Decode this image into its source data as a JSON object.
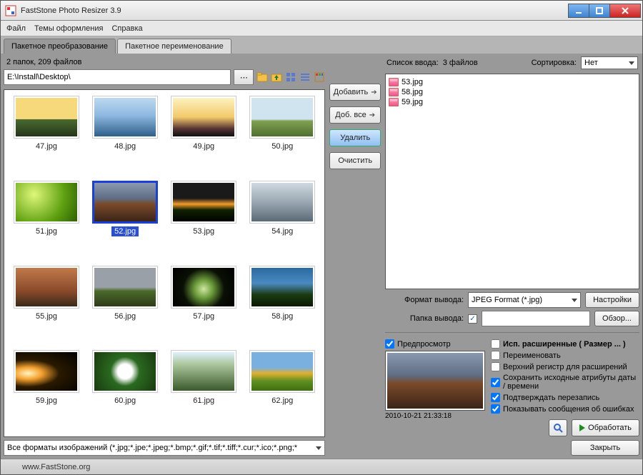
{
  "title": "FastStone Photo Resizer 3.9",
  "menus": {
    "file": "Файл",
    "themes": "Темы оформления",
    "help": "Справка"
  },
  "tabs": {
    "convert": "Пакетное преобразование",
    "rename": "Пакетное переименование"
  },
  "folder_info": "2 папок, 209 файлов",
  "path": "E:\\Install\\Desktop\\",
  "thumbs": [
    {
      "name": "47.jpg",
      "cls": "g-sunset"
    },
    {
      "name": "48.jpg",
      "cls": "g-aerial"
    },
    {
      "name": "49.jpg",
      "cls": "g-sky"
    },
    {
      "name": "50.jpg",
      "cls": "g-field"
    },
    {
      "name": "51.jpg",
      "cls": "g-leaf"
    },
    {
      "name": "52.jpg",
      "cls": "g-mount",
      "selected": true
    },
    {
      "name": "53.jpg",
      "cls": "g-dusk"
    },
    {
      "name": "54.jpg",
      "cls": "g-snowmt"
    },
    {
      "name": "55.jpg",
      "cls": "g-canyon"
    },
    {
      "name": "56.jpg",
      "cls": "g-barn"
    },
    {
      "name": "57.jpg",
      "cls": "g-cave"
    },
    {
      "name": "58.jpg",
      "cls": "g-fantasy"
    },
    {
      "name": "59.jpg",
      "cls": "g-space"
    },
    {
      "name": "60.jpg",
      "cls": "g-flower"
    },
    {
      "name": "61.jpg",
      "cls": "g-forest"
    },
    {
      "name": "62.jpg",
      "cls": "g-meadow"
    }
  ],
  "ext_filter": "Все форматы изображений (*.jpg;*.jpe;*.jpeg;*.bmp;*.gif;*.tif;*.tiff;*.cur;*.ico;*.png;*",
  "midbtns": {
    "add": "Добавить",
    "addall": "Доб. все",
    "remove": "Удалить",
    "clear": "Очистить"
  },
  "input_list": {
    "label": "Список ввода:",
    "count": "3 файлов",
    "items": [
      "53.jpg",
      "58.jpg",
      "59.jpg"
    ]
  },
  "sort": {
    "label": "Сортировка:",
    "value": "Нет"
  },
  "out_format": {
    "label": "Формат вывода:",
    "value": "JPEG Format (*.jpg)",
    "settings": "Настройки"
  },
  "out_folder": {
    "label": "Папка вывода:",
    "browse": "Обзор..."
  },
  "preview": {
    "check": "Предпросмотр",
    "timestamp": "2010-10-21 21:33:18"
  },
  "opts": {
    "advanced": "Исп. расширенные ( Размер ... )",
    "rename": "Переименовать",
    "upper": "Верхний регистр для расширений",
    "keepdate": "Сохранить исходные атрибуты даты / времени",
    "confirm": "Подтверждать перезапись",
    "errors": "Показывать сообщения об ошибках"
  },
  "actions": {
    "run": "Обработать",
    "close": "Закрыть"
  },
  "statusbar": "www.FastStone.org"
}
